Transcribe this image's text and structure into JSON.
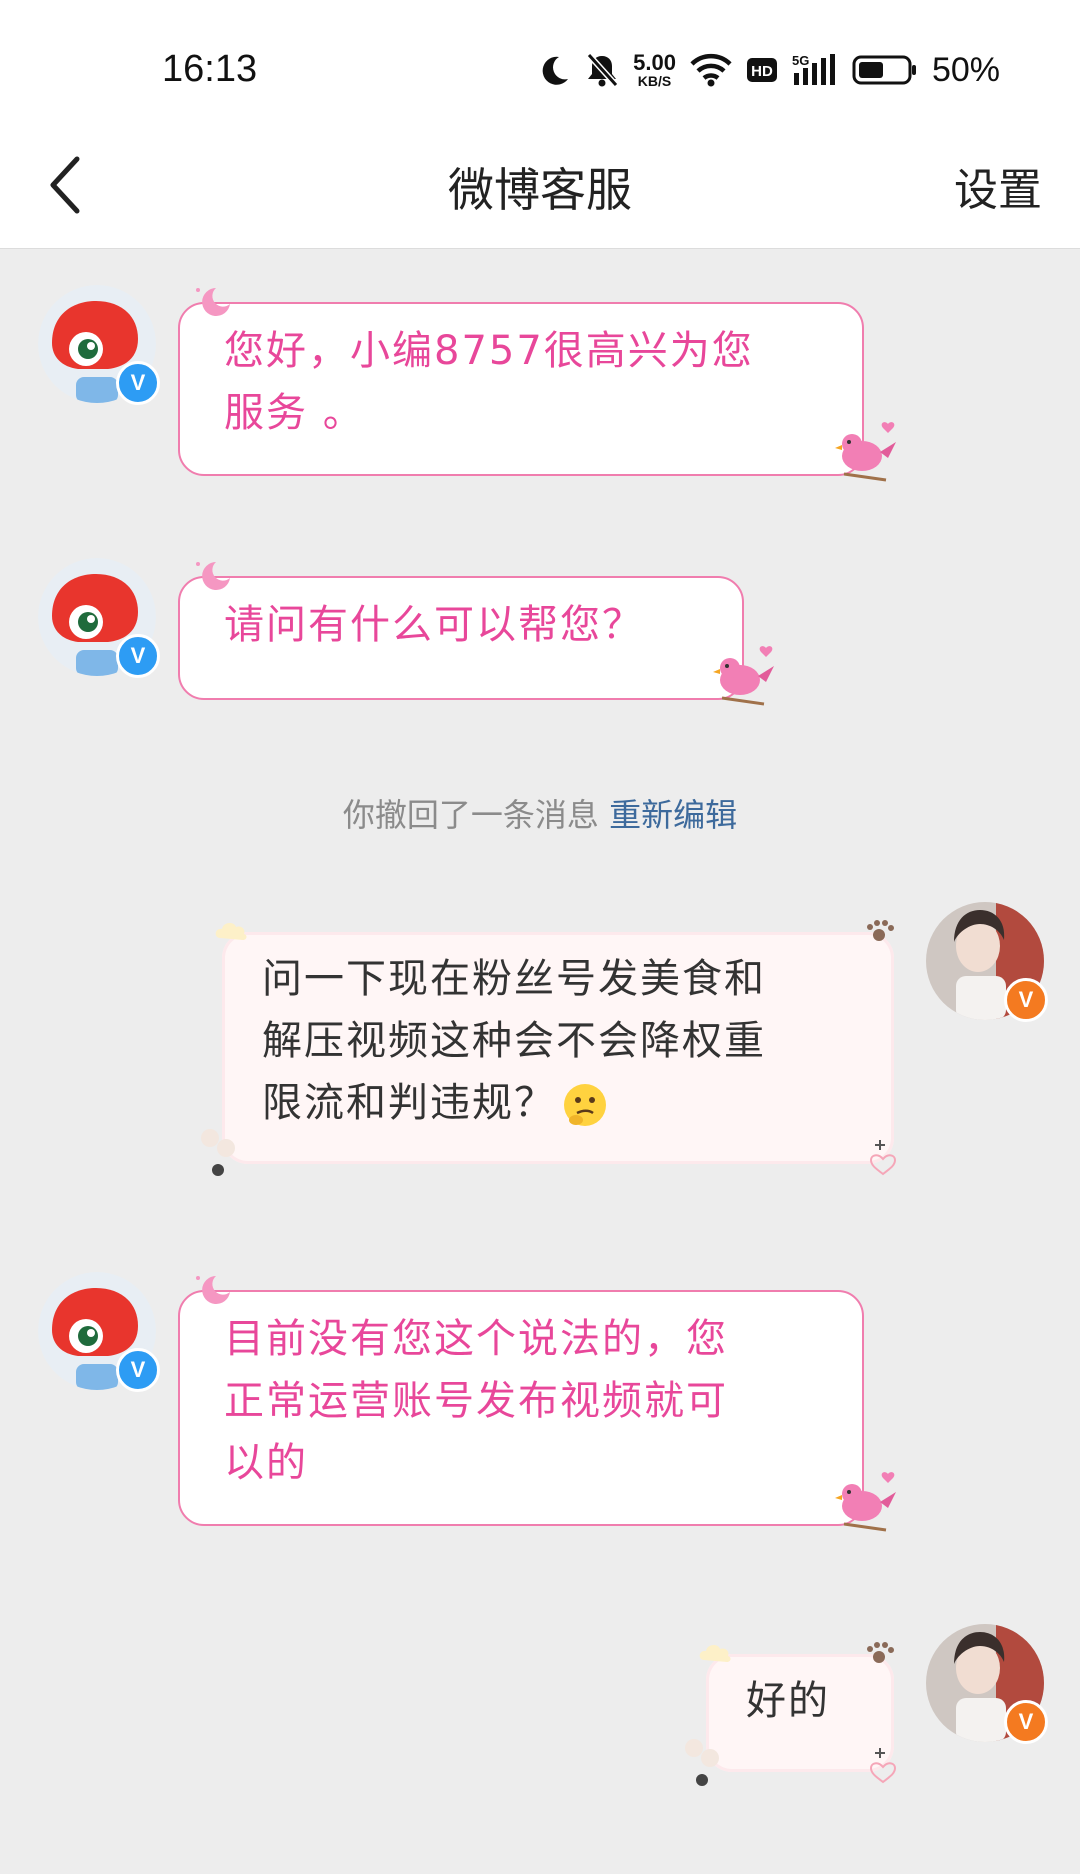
{
  "status_bar": {
    "time": "16:13",
    "net_speed_value": "5.00",
    "net_speed_unit": "KB/S",
    "battery_percent": "50%"
  },
  "header": {
    "title": "微博客服",
    "settings_label": "设置"
  },
  "messages": [
    {
      "from": "service",
      "lines": [
        "您好，小编8757很高兴为您",
        "服务 。"
      ]
    },
    {
      "from": "service",
      "lines": [
        "请问有什么可以帮您？"
      ]
    },
    {
      "from": "system",
      "text": "你撤回了一条消息",
      "link": "重新编辑"
    },
    {
      "from": "user",
      "lines": [
        "问一下现在粉丝号发美食和",
        "解压视频这种会不会降权重",
        "限流和判违规？"
      ]
    },
    {
      "from": "service",
      "lines": [
        "目前没有您这个说法的，您",
        "正常运营账号发布视频就可",
        "以的"
      ]
    },
    {
      "from": "user",
      "lines": [
        "好的"
      ]
    }
  ],
  "colors": {
    "service_text": "#e8479a",
    "service_border": "#f07dae",
    "user_bubble": "#fff6f6",
    "link": "#3d6a9c",
    "service_badge": "#2d9cf4",
    "user_badge": "#f47a20"
  },
  "icons": {
    "back": "chevron-left-icon",
    "moon": "moon-icon",
    "mute": "bell-off-icon",
    "wifi": "wifi-icon",
    "hd": "hd-icon",
    "signal": "signal-5g-icon",
    "battery": "battery-icon",
    "badge_service": "verified-v-icon",
    "badge_user": "verified-v-icon"
  },
  "badges": {
    "verified_letter": "V"
  }
}
